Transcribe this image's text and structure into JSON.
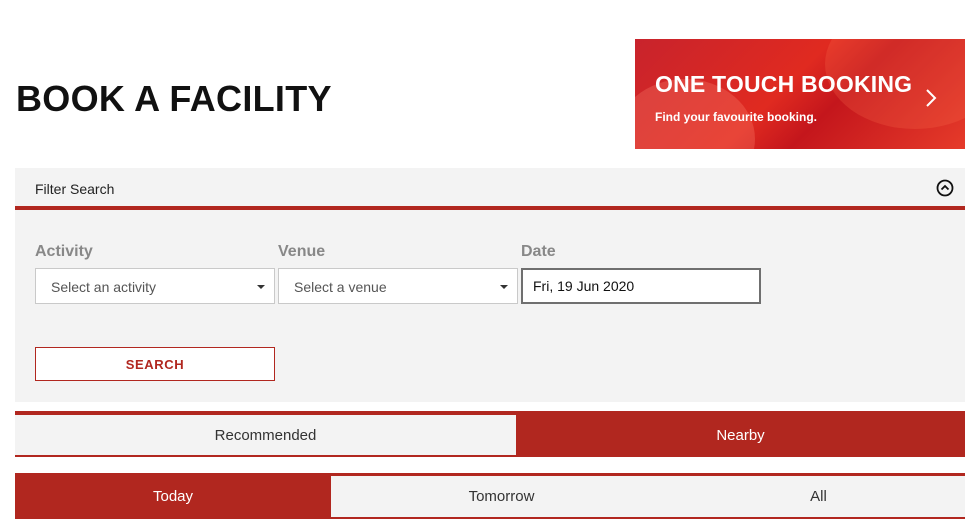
{
  "page": {
    "title": "BOOK A FACILITY"
  },
  "promo": {
    "title": "ONE TOUCH BOOKING",
    "subtitle": "Find your favourite booking.",
    "chevron_icon": "chevron-right-icon"
  },
  "filter": {
    "header_label": "Filter Search",
    "collapse_icon": "circle-chevron-up-icon",
    "activity": {
      "label": "Activity",
      "placeholder": "Select an activity"
    },
    "venue": {
      "label": "Venue",
      "placeholder": "Select a venue"
    },
    "date": {
      "label": "Date",
      "value": "Fri, 19 Jun 2020"
    },
    "search_label": "SEARCH"
  },
  "sort_tabs": [
    {
      "label": "Recommended",
      "active": false
    },
    {
      "label": "Nearby",
      "active": true
    }
  ],
  "day_tabs": [
    {
      "label": "Today",
      "active": true
    },
    {
      "label": "Tomorrow",
      "active": false
    },
    {
      "label": "All",
      "active": false
    }
  ],
  "colors": {
    "accent": "#b1271f",
    "panel": "#f3f3f3",
    "banner": "#d9261f"
  }
}
